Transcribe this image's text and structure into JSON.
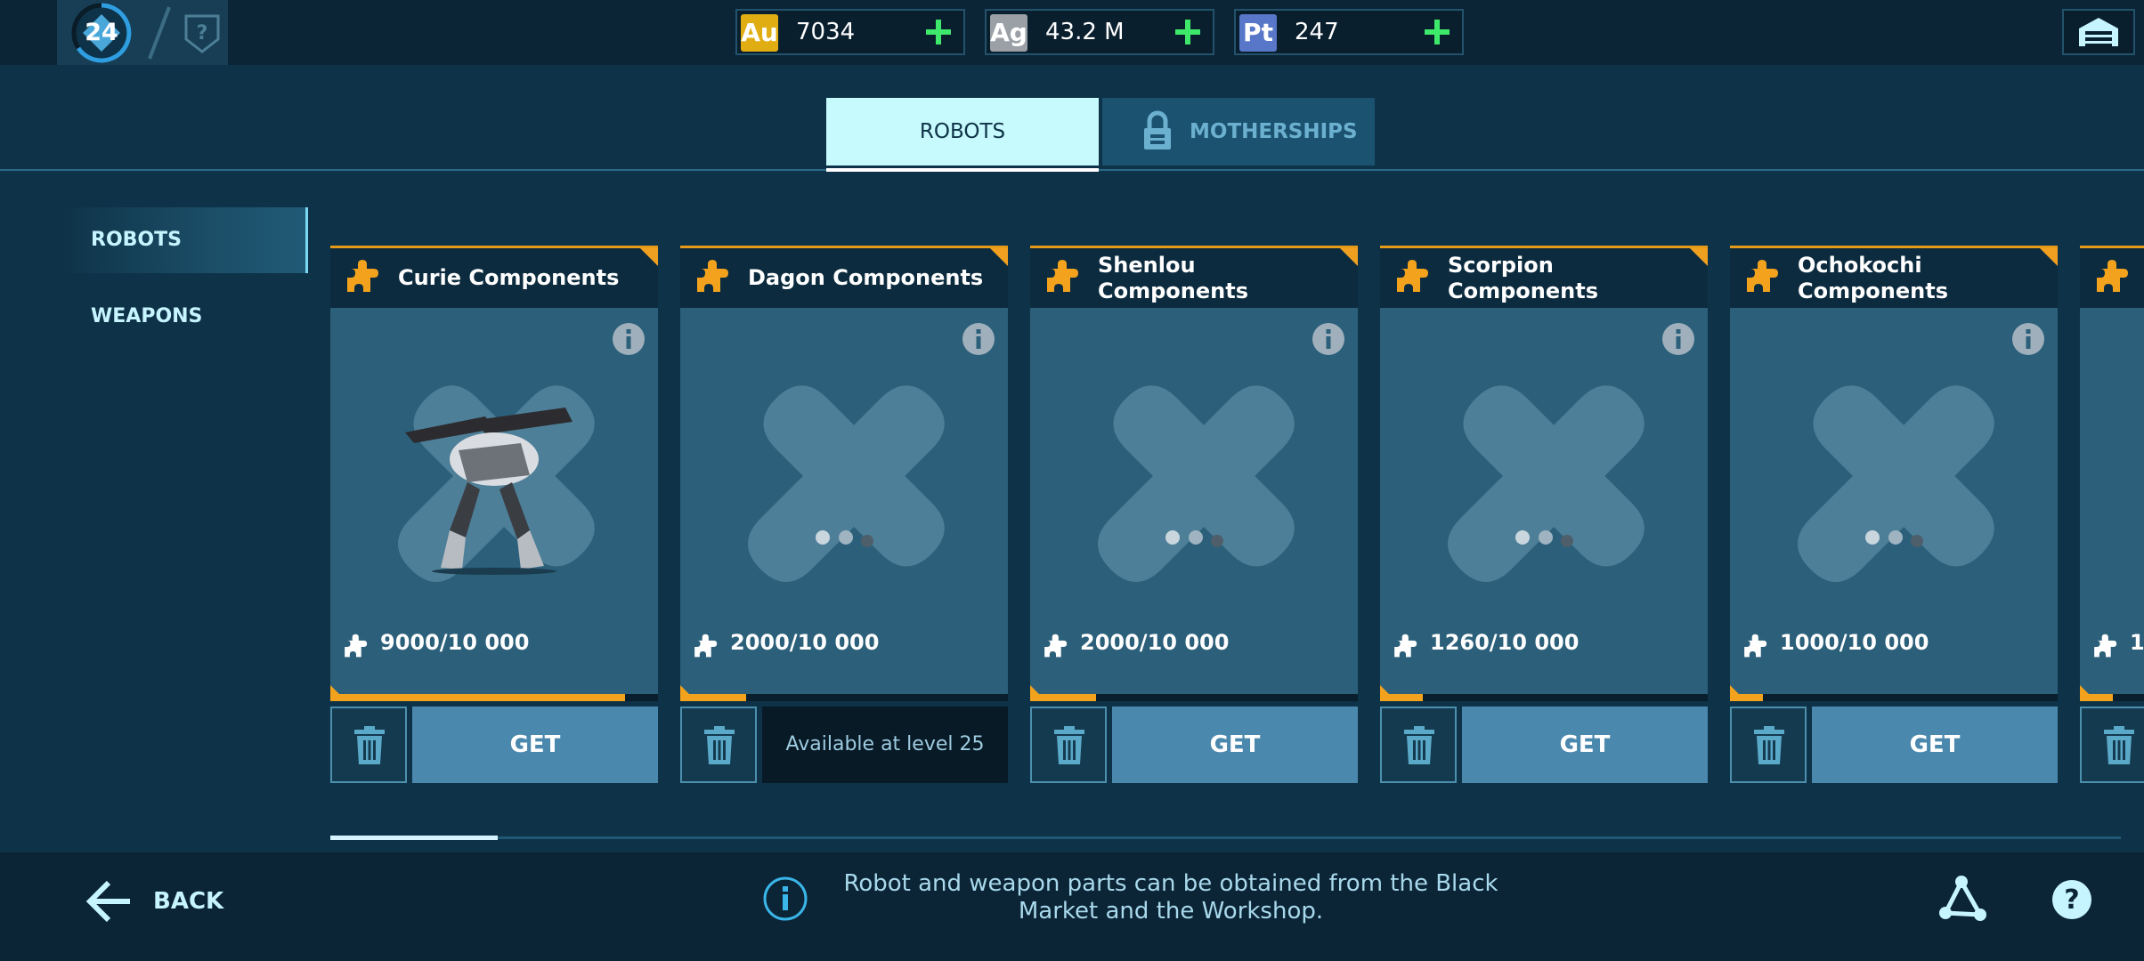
{
  "player": {
    "level": "24"
  },
  "currencies": [
    {
      "code": "Au",
      "value": "7034",
      "color": "#e0ad13"
    },
    {
      "code": "Ag",
      "value": "43.2 M",
      "color": "#9aa0a6"
    },
    {
      "code": "Pt",
      "value": "247",
      "color": "#5877c9"
    }
  ],
  "tabs": {
    "robots": "ROBOTS",
    "motherships": "MOTHERSHIPS"
  },
  "sidebar": {
    "items": [
      {
        "label": "ROBOTS"
      },
      {
        "label": "WEAPONS"
      }
    ]
  },
  "cards": [
    {
      "title": "Curie Components",
      "progress": "9000/10 000",
      "fraction": 0.9,
      "action": "GET",
      "state": "robot-image"
    },
    {
      "title": "Dagon Components",
      "progress": "2000/10 000",
      "fraction": 0.2,
      "action": "Available at level 25",
      "state": "locked"
    },
    {
      "title": "Shenlou Components",
      "progress": "2000/10 000",
      "fraction": 0.2,
      "action": "GET",
      "state": "loading"
    },
    {
      "title": "Scorpion Components",
      "progress": "1260/10 000",
      "fraction": 0.126,
      "action": "GET",
      "state": "loading"
    },
    {
      "title": "Ochokochi Components",
      "progress": "1000/10 000",
      "fraction": 0.1,
      "action": "GET",
      "state": "loading"
    },
    {
      "title": "",
      "progress": "1",
      "fraction": 0.1,
      "action": "",
      "state": "partial"
    }
  ],
  "footer": {
    "back_label": "BACK",
    "info_text": "Robot and weapon parts can be obtained from the Black Market and the Workshop."
  },
  "colors": {
    "accent": "#f2a21c",
    "get_button": "#4b88ad",
    "plus": "#3ee86a"
  }
}
